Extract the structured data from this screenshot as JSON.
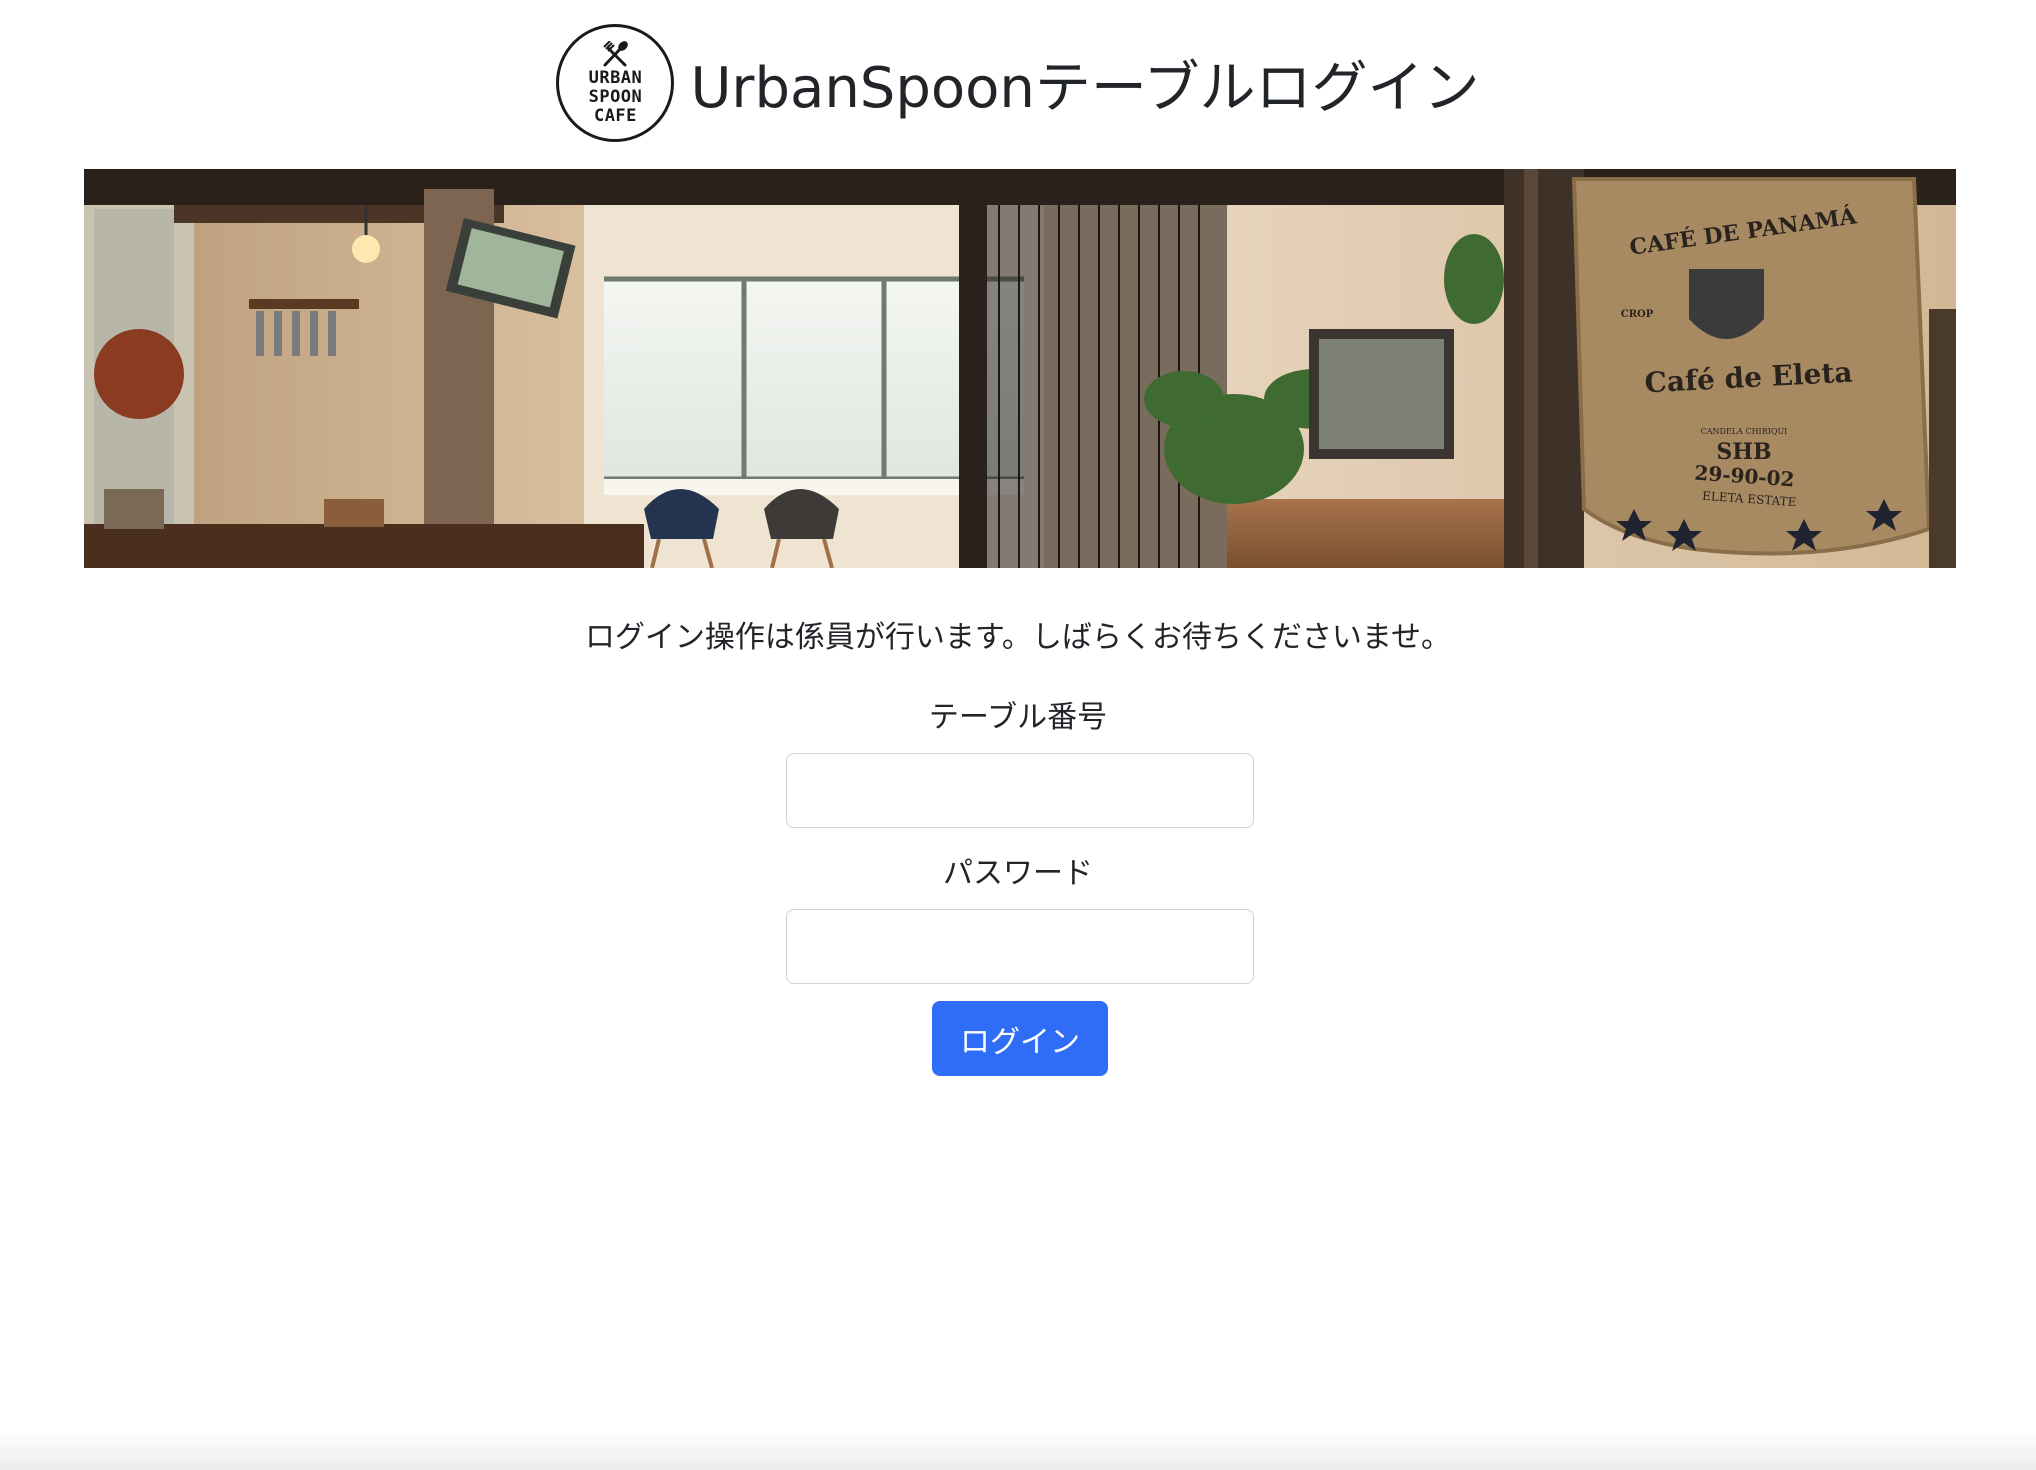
{
  "header": {
    "title": "UrbanSpoonテーブルログイン",
    "logo_lines": [
      "URBAN",
      "SPOON",
      "CAFE"
    ]
  },
  "banner": {
    "sign_lines": [
      "CAFÉ DE PANAMÁ",
      "CROP",
      "Café de Eleta",
      "CANDELA CHIRIQUI",
      "SHB",
      "29-90-02",
      "ELETA   ESTATE"
    ]
  },
  "form": {
    "notice": "ログイン操作は係員が行います。しばらくお待ちくださいませ。",
    "table_label": "テーブル番号",
    "table_value": "",
    "password_label": "パスワード",
    "password_value": "",
    "submit_label": "ログイン"
  },
  "colors": {
    "primary": "#2f6df6",
    "text": "#212529",
    "input_border": "#ced4da"
  }
}
